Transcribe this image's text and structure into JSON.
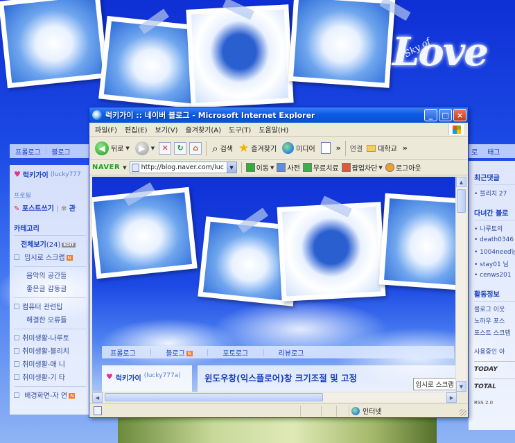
{
  "background_blog": {
    "logo_text": "Love",
    "logo_small": "Sky of",
    "left_tabs": [
      "프롤로그",
      "블로그"
    ],
    "profile_name": "럭키가이",
    "profile_id": "(lucky777",
    "profile_label": "프로필",
    "post_write": "포스트쓰기",
    "post_manage": "관",
    "category_heading": "카테고리",
    "categories": [
      {
        "label": "전체보기",
        "count": "(24)",
        "badge": "EDIT",
        "style": "strong"
      },
      {
        "label": "임시로 스크랩",
        "badge": "N",
        "style": "box"
      },
      {
        "label": "음악의 공간들",
        "style": "plain"
      },
      {
        "label": "좋은글 감동글",
        "style": "plain"
      },
      {
        "label": "컴퓨터 관련팁",
        "style": "box"
      },
      {
        "label": "해결한 오류들",
        "style": "plain"
      },
      {
        "label": "취미생활-나루토",
        "style": "box"
      },
      {
        "label": "취미생활-블리치",
        "style": "box"
      },
      {
        "label": "취미생활-애 니",
        "style": "box"
      },
      {
        "label": "취미생활-기 타",
        "style": "box"
      },
      {
        "label": "배경화면-자 연",
        "badge": "N",
        "style": "box"
      }
    ],
    "right_tabs": [
      "로",
      "태그"
    ],
    "right_sections": [
      {
        "heading": "최근댓글",
        "items": [
          "블리치 27"
        ]
      },
      {
        "heading": "다녀간 블로",
        "items": [
          "나루토의",
          "death0346",
          "1004need님",
          "stay01 님",
          "cenws201"
        ]
      }
    ],
    "activity_heading": "활동정보",
    "activity_lines": [
      "블로그 이웃",
      "노하우 포스",
      "포스트 스크랩"
    ],
    "using_line": "사용중인 아",
    "stats": [
      "TODAY",
      "TOTAL"
    ],
    "rss": "RSS 2.0"
  },
  "ie_window": {
    "title": "럭키가이 :: 네이버 블로그 - Microsoft Internet Explorer",
    "window_buttons": {
      "minimize": "_",
      "maximize": "□",
      "close": "×"
    },
    "menu": [
      "파일(F)",
      "편집(E)",
      "보기(V)",
      "즐겨찾기(A)",
      "도구(T)",
      "도움말(H)"
    ],
    "toolbar": {
      "back": "뒤로",
      "search": "검색",
      "favorites": "즐겨찾기",
      "media": "미디어",
      "links_label": "연결",
      "link_folder": "대학교"
    },
    "address_bar": {
      "brand": "NAVER",
      "url": "http://blog.naver.com/luc",
      "buttons": [
        "이동",
        "사전",
        "무료치료",
        "팝업차단",
        "로그아웃"
      ]
    },
    "content": {
      "tabs": [
        "프롤로그",
        "블로그",
        "포토로그",
        "리뷰로그"
      ],
      "profile_name": "럭키가이",
      "profile_id": "(lucky777a)",
      "post_title": "윈도우창(익스플로어)창 크기조절 및 고정",
      "scrap_category": "임시로 스크랩"
    },
    "status_zone": "인터넷"
  }
}
